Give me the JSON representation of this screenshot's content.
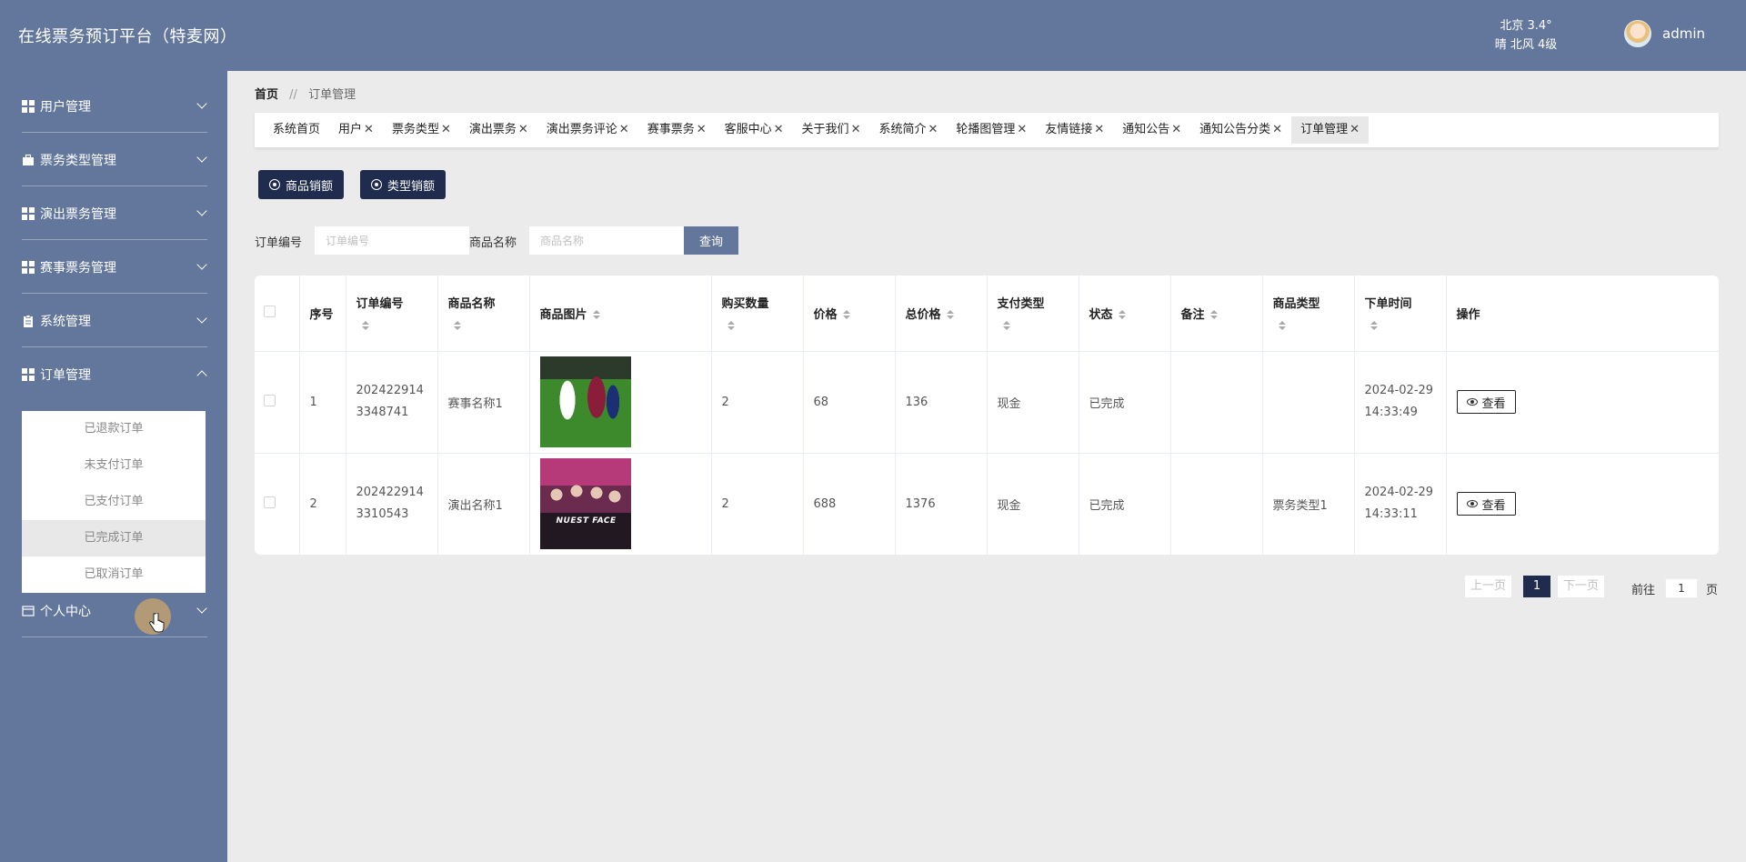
{
  "header": {
    "title": "在线票务预订平台（特麦网）",
    "weather_line1": "北京  3.4°",
    "weather_line2": "晴  北风  4级",
    "username": "admin"
  },
  "sidebar": {
    "items": [
      {
        "label": "用户管理",
        "icon": "grid-icon"
      },
      {
        "label": "票务类型管理",
        "icon": "briefcase-icon"
      },
      {
        "label": "演出票务管理",
        "icon": "grid-icon"
      },
      {
        "label": "赛事票务管理",
        "icon": "grid-icon"
      },
      {
        "label": "系统管理",
        "icon": "clipboard-icon"
      },
      {
        "label": "订单管理",
        "icon": "grid-icon"
      },
      {
        "label": "个人中心",
        "icon": "card-icon"
      }
    ],
    "submenu": [
      "已退款订单",
      "未支付订单",
      "已支付订单",
      "已完成订单",
      "已取消订单"
    ]
  },
  "breadcrumb": {
    "home": "首页",
    "sep": "//",
    "current": "订单管理"
  },
  "tabs": [
    "系统首页",
    "用户",
    "票务类型",
    "演出票务",
    "演出票务评论",
    "赛事票务",
    "客服中心",
    "关于我们",
    "系统简介",
    "轮播图管理",
    "友情链接",
    "通知公告",
    "通知公告分类",
    "订单管理"
  ],
  "actions": {
    "btn1": "商品销额",
    "btn2": "类型销额"
  },
  "search": {
    "order_no_label": "订单编号",
    "order_no_placeholder": "订单编号",
    "product_label": "商品名称",
    "product_placeholder": "商品名称",
    "query": "查询"
  },
  "table": {
    "headers": [
      "序号",
      "订单编号",
      "商品名称",
      "商品图片",
      "购买数量",
      "价格",
      "总价格",
      "支付类型",
      "状态",
      "备注",
      "商品类型",
      "下单时间",
      "操作"
    ],
    "rows": [
      {
        "idx": "1",
        "order_no_a": "202422914",
        "order_no_b": "3348741",
        "name": "赛事名称1",
        "qty": "2",
        "price": "68",
        "total": "136",
        "pay": "现金",
        "status": "已完成",
        "note": "",
        "type": "",
        "date": "2024-02-29",
        "time": "14:33:49",
        "action": "查看"
      },
      {
        "idx": "2",
        "order_no_a": "202422914",
        "order_no_b": "3310543",
        "name": "演出名称1",
        "qty": "2",
        "price": "688",
        "total": "1376",
        "pay": "现金",
        "status": "已完成",
        "note": "",
        "type": "票务类型1",
        "date": "2024-02-29",
        "time": "14:33:11",
        "action": "查看"
      }
    ],
    "poster_brand": "NUEST FACE"
  },
  "pagination": {
    "prev": "上一页",
    "page": "1",
    "next": "下一页",
    "goto": "前往",
    "goto_value": "1",
    "unit": "页"
  }
}
